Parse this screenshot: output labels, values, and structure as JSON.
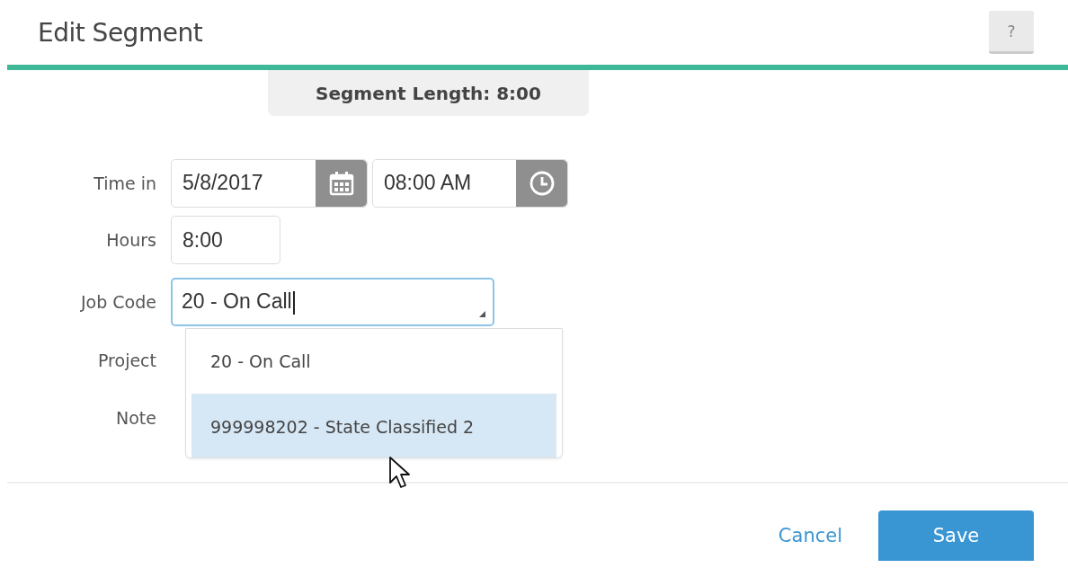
{
  "dialog": {
    "title": "Edit Segment",
    "help_button": "?"
  },
  "segment_length": "Segment Length: 8:00",
  "fields": [
    {
      "kind": "datetime",
      "label": "Time in",
      "date": "5/8/2017",
      "time": "08:00 AM"
    },
    {
      "kind": "text",
      "label": "Hours",
      "value": "8:00"
    },
    {
      "kind": "combo",
      "label": "Job Code",
      "value": "20 - On Call",
      "focused": true
    },
    {
      "kind": "label",
      "label": "Project"
    },
    {
      "kind": "label",
      "label": "Note"
    }
  ],
  "dropdown": {
    "options": [
      {
        "label": "20 - On Call",
        "selected": false
      },
      {
        "label": "999998202 - State Classified 2",
        "selected": true
      }
    ]
  },
  "buttons": [
    {
      "kind": "link",
      "label": "Cancel"
    },
    {
      "kind": "primary",
      "label": "Save"
    }
  ]
}
